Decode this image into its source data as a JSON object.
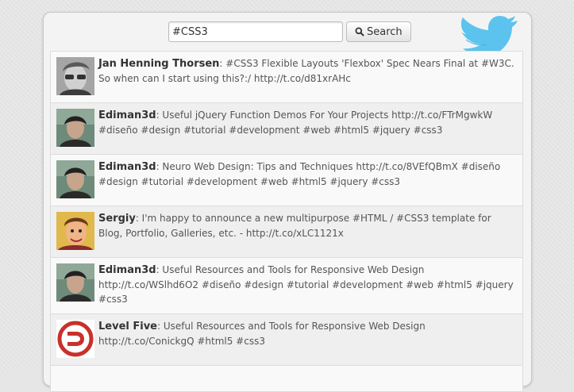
{
  "search": {
    "value": "#CSS3",
    "button_label": "Search"
  },
  "tweets": [
    {
      "author": "Jan Henning Thorsen",
      "text": ": #CSS3 Flexible Layouts 'Flexbox' Spec Nears Final at #W3C. So when can I start using this?:/ http://t.co/d81xrAHc",
      "avatar": "portrait-glasses"
    },
    {
      "author": "Ediman3d",
      "text": ": Useful jQuery Function Demos For Your Projects http://t.co/FTrMgwkW #diseño #design #tutorial #development #web #html5 #jquery #css3",
      "avatar": "portrait-dark-hair"
    },
    {
      "author": "Ediman3d",
      "text": ": Neuro Web Design: Tips and Techniques http://t.co/8VEfQBmX #diseño #design #tutorial #development #web #html5 #jquery #css3",
      "avatar": "portrait-dark-hair"
    },
    {
      "author": "Sergiy",
      "text": ": I'm happy to announce a new multipurpose #HTML / #CSS3 template for Blog, Portfolio, Galleries, etc. - http://t.co/xLC1121x",
      "avatar": "cartoon-portrait"
    },
    {
      "author": "Ediman3d",
      "text": ": Useful Resources and Tools for Responsive Web Design http://t.co/WSlhd6O2 #diseño #design #tutorial #development #web #html5 #jquery #css3",
      "avatar": "portrait-dark-hair"
    },
    {
      "author": "Level Five",
      "text": ": Useful Resources and Tools for Responsive Web Design http://t.co/ConickgQ #html5 #css3",
      "avatar": "red-d-logo"
    },
    {
      "author": "",
      "text": "",
      "avatar": ""
    }
  ]
}
